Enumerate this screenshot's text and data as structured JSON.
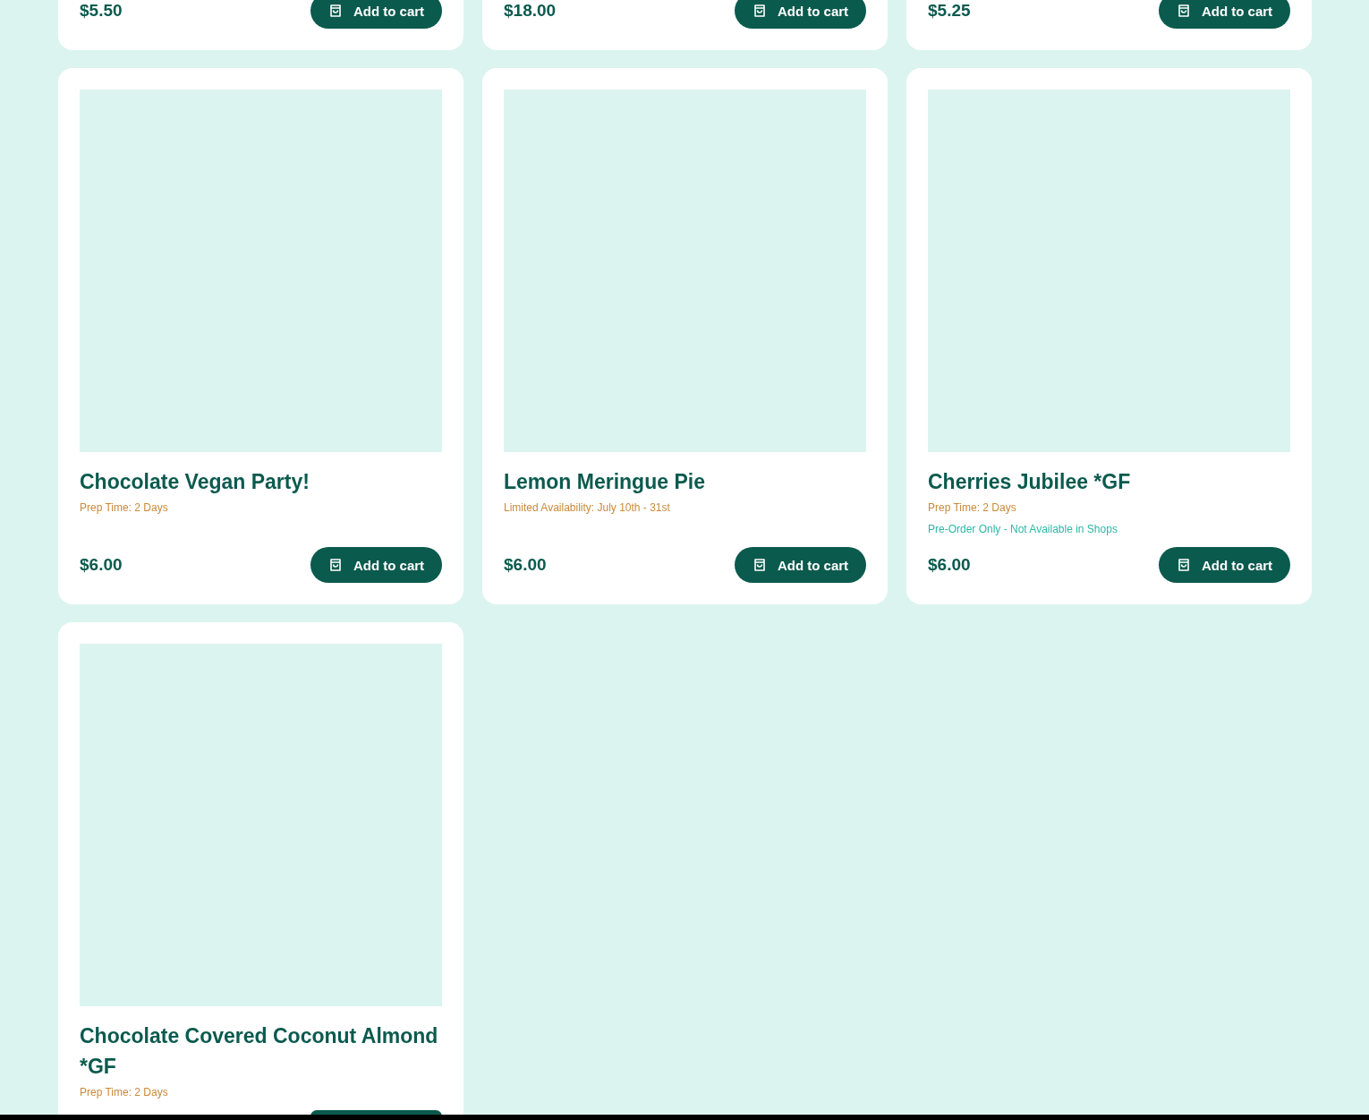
{
  "products_above": [
    {
      "price": "$5.50",
      "button": "Add to cart"
    },
    {
      "price": "$18.00",
      "button": "Add to cart"
    },
    {
      "price": "$5.25",
      "button": "Add to cart"
    }
  ],
  "products": [
    {
      "image": {
        "kind": "picture"
      },
      "name": "Chocolate Vegan Party!",
      "notes": [
        {
          "kind": "info",
          "text": "Prep Time: 2 Days"
        }
      ],
      "price": "$6.00",
      "button": "Add to cart"
    },
    {
      "image": {
        "kind": "picture"
      },
      "name": "Lemon Meringue Pie",
      "notes": [
        {
          "kind": "info",
          "text": "Limited Availability: July 10th - 31st"
        }
      ],
      "price": "$6.00",
      "button": "Add to cart"
    },
    {
      "image": {
        "kind": "picture"
      },
      "name": "Cherries Jubilee *GF",
      "notes": [
        {
          "kind": "info",
          "text": "Prep Time: 2 Days"
        },
        {
          "kind": "notice",
          "text": "Pre-Order Only - Not Available in Shops"
        }
      ],
      "price": "$6.00",
      "button": "Add to cart"
    },
    {
      "image": {
        "kind": "picture"
      },
      "name": "Chocolate Covered Coconut Almond *GF",
      "notes": [
        {
          "kind": "info",
          "text": "Prep Time: 2 Days"
        }
      ],
      "button_edge": true
    }
  ]
}
